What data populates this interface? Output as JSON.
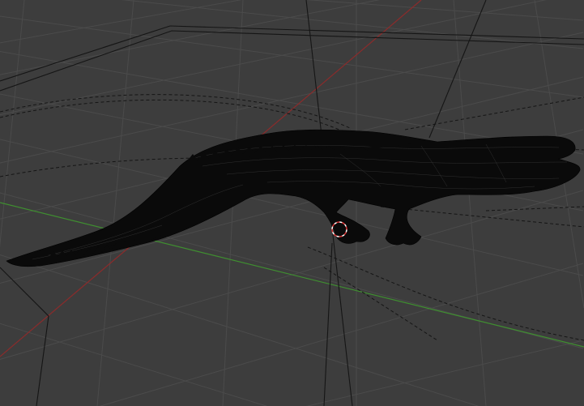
{
  "viewport": {
    "background": "#3d3d3d",
    "grid_color": "#4a4a4a",
    "x_axis_color": "#8b2b2b",
    "y_axis_color": "#3f8f30",
    "wire_color": "#111111",
    "mesh_color": "#0a0a0a",
    "mesh_highlight_color": "#5a5a5a",
    "cursor_color": "#d83535",
    "object": "alligator",
    "shading": "wireframe"
  },
  "icons": {
    "cursor": "3d-cursor-icon"
  }
}
